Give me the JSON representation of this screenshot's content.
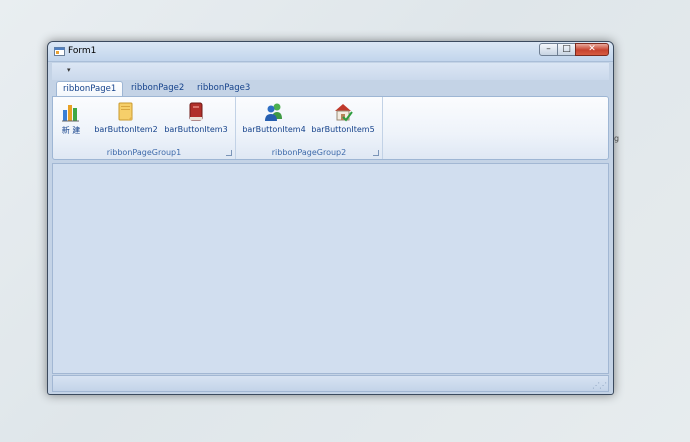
{
  "window": {
    "title": "Form1"
  },
  "quick_access": {
    "customize_glyph": "▾"
  },
  "ribbon": {
    "tabs": [
      {
        "label": "ribbonPage1",
        "active": true
      },
      {
        "label": "ribbonPage2",
        "active": false
      },
      {
        "label": "ribbonPage3",
        "active": false
      }
    ],
    "groups": [
      {
        "caption": "ribbonPageGroup1",
        "buttons": [
          {
            "label": "新 建",
            "icon": "bar-chart-icon"
          },
          {
            "label": "barButtonItem2",
            "icon": "note-icon"
          },
          {
            "label": "barButtonItem3",
            "icon": "book-icon"
          }
        ]
      },
      {
        "caption": "ribbonPageGroup2",
        "buttons": [
          {
            "label": "barButtonItem4",
            "icon": "users-icon"
          },
          {
            "label": "barButtonItem5",
            "icon": "home-check-icon"
          }
        ]
      }
    ]
  },
  "stray_text": "g",
  "colors": {
    "accent": "#15428b",
    "client_background": "#d1deef",
    "close_button": "#c7432f"
  }
}
